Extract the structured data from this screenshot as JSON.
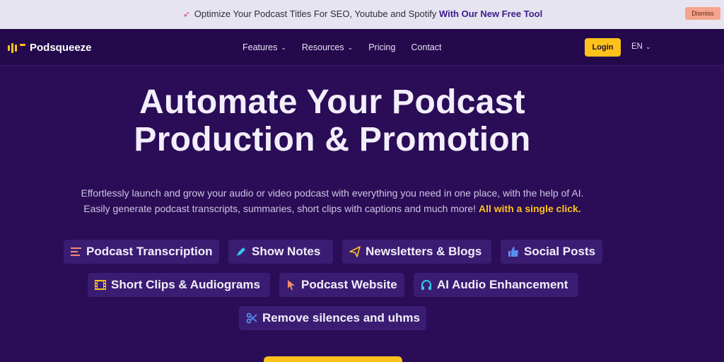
{
  "announcement": {
    "icon": "rocket-icon",
    "text": "Optimize Your Podcast Titles For SEO, Youtube and Spotify",
    "link": "With Our New Free Tool",
    "dismiss": "Dismiss"
  },
  "nav": {
    "brand": "Podsqueeze",
    "links": [
      "Features",
      "Resources",
      "Pricing",
      "Contact"
    ],
    "login": "Login",
    "language": "EN"
  },
  "hero": {
    "title_line1": "Automate Your Podcast",
    "title_line2": "Production & Promotion",
    "sub_line1": "Effortlessly launch and grow your audio or video podcast with everything you need in one place, with the help of AI.",
    "sub_line2": "Easily generate podcast transcripts, summaries, short clips with captions and much more!",
    "sub_highlight": "All with a single click."
  },
  "features": [
    {
      "label": "Podcast Transcription",
      "icon": "list-icon",
      "color": "#f08a6c"
    },
    {
      "label": "Show Notes",
      "icon": "pen-icon",
      "color": "#38c6e8"
    },
    {
      "label": "Newsletters & Blogs",
      "icon": "paper-plane-icon",
      "color": "#ffc21a"
    },
    {
      "label": "Social Posts",
      "icon": "thumbs-up-icon",
      "color": "#5a8ef0"
    },
    {
      "label": "Short Clips & Audiograms",
      "icon": "film-icon",
      "color": "#ffc21a"
    },
    {
      "label": "Podcast Website",
      "icon": "cursor-icon",
      "color": "#f08a6c"
    },
    {
      "label": "AI Audio Enhancement",
      "icon": "headphones-icon",
      "color": "#38c6e8"
    },
    {
      "label": "Remove silences and uhms",
      "icon": "scissors-icon",
      "color": "#5a8ef0"
    }
  ],
  "colors": {
    "accent": "#ffc21a",
    "background": "#2a0c57",
    "chip": "#3a1d72"
  }
}
